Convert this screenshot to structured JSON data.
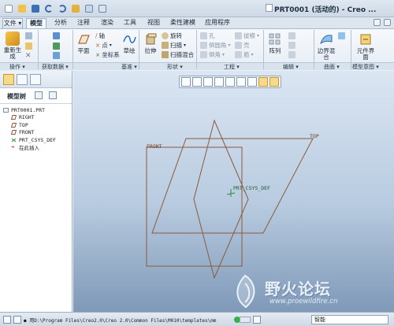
{
  "title_bar": {
    "title": "PRT0001 (活动的) - Creo ...",
    "quick_access": [
      "new-icon",
      "open-icon",
      "save-icon",
      "undo-icon",
      "redo-icon",
      "regenerate-icon",
      "windows-icon",
      "close-window-icon"
    ]
  },
  "menu_tabs": [
    "文件 ▾",
    "模型",
    "分析",
    "注释",
    "渲染",
    "工具",
    "视图",
    "柔性建模",
    "应用程序"
  ],
  "active_tab": "模型",
  "ribbon": {
    "operations": {
      "group_label": "操作 ▾",
      "regenerate_label": "重新生成"
    },
    "get_data": {
      "group_label": "获取数据 ▾"
    },
    "datum": {
      "group_label": "基准 ▾",
      "plane_label": "平面",
      "axis_label": "轴",
      "point_label": "点",
      "csys_label": "坐标系",
      "sketch_label": "草绘"
    },
    "shapes": {
      "group_label": "形状 ▾",
      "extrude_label": "拉伸",
      "revolve_label": "旋转",
      "sweep_label": "扫描",
      "swept_blend_label": "扫描混合"
    },
    "engineering": {
      "group_label": "工程 ▾",
      "hole_label": "孔",
      "round_label": "倒圆角",
      "chamfer_label": "倒角",
      "draft_label": "拔模",
      "shell_label": "壳",
      "rib_label": "筋"
    },
    "editing": {
      "group_label": "编辑 ▾",
      "pattern_label": "阵列"
    },
    "surfaces": {
      "group_label": "曲面 ▾",
      "boundary_blend_label": "边界混合"
    },
    "model_intent": {
      "group_label": "模型意图 ▾",
      "component_interface_label": "元件界面"
    }
  },
  "model_tree": {
    "header": "模型树",
    "nodes": [
      {
        "label": "PRT0001.PRT",
        "icon": "part-icon"
      },
      {
        "label": "RIGHT",
        "icon": "datum-plane-icon"
      },
      {
        "label": "TOP",
        "icon": "datum-plane-icon"
      },
      {
        "label": "FRONT",
        "icon": "datum-plane-icon"
      },
      {
        "label": "PRT_CSYS_DEF",
        "icon": "csys-icon"
      },
      {
        "label": "在此插入",
        "icon": "insert-arrow-icon"
      }
    ]
  },
  "view_toolbar": [
    "refit-icon",
    "zoom-in-icon",
    "zoom-out-icon",
    "repaint-icon",
    "display-style-icon",
    "saved-orientations-icon",
    "view-manager-icon",
    "datum-display-icon",
    "spin-center-icon"
  ],
  "graphics": {
    "plane_labels": {
      "front": "FRONT",
      "top": "TOP",
      "csys": "PRT_CSYS_DEF"
    },
    "colors": {
      "datum_plane": "#8a5a3a",
      "csys": "#2c8c3c"
    }
  },
  "status_bar": {
    "message": "● 用D:\\Program Files\\Creo2.0\\Creo 2.0\\Common Files\\M010\\templates\\mm",
    "filter_value": "智能"
  },
  "watermark": {
    "text": "野火论坛",
    "url": "www.proewildfire.cn"
  }
}
